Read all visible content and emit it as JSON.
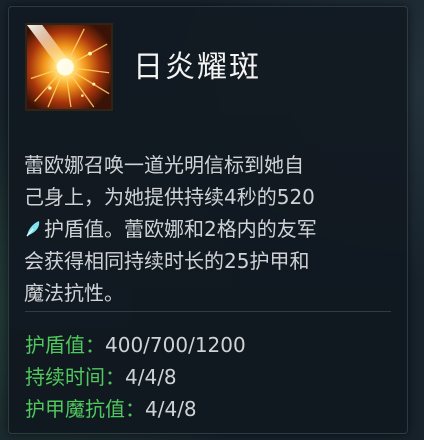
{
  "ability": {
    "name": "日炎耀斑",
    "icon": "sun-flare-icon"
  },
  "description": {
    "line1": "蕾欧娜召唤一道光明信标到她自",
    "line2": "己身上，为她提供持续4秒的520",
    "line3_text": "护盾值。蕾欧娜和2格内的友军",
    "line3_icon": "ability-power-icon",
    "line4": "会获得相同持续时长的25护甲和",
    "line5": "魔法抗性。"
  },
  "stats": [
    {
      "label": "护盾值：",
      "value": "400/700/1200"
    },
    {
      "label": "持续时间：",
      "value": "4/4/8"
    },
    {
      "label": "护甲魔抗值：",
      "value": "4/4/8"
    }
  ],
  "colors": {
    "background": "#17222b",
    "title": "#f3f3f3",
    "text": "#cfd3d6",
    "stat_label": "#4fc95d",
    "ability_power_icon": "#7fe3f0"
  }
}
